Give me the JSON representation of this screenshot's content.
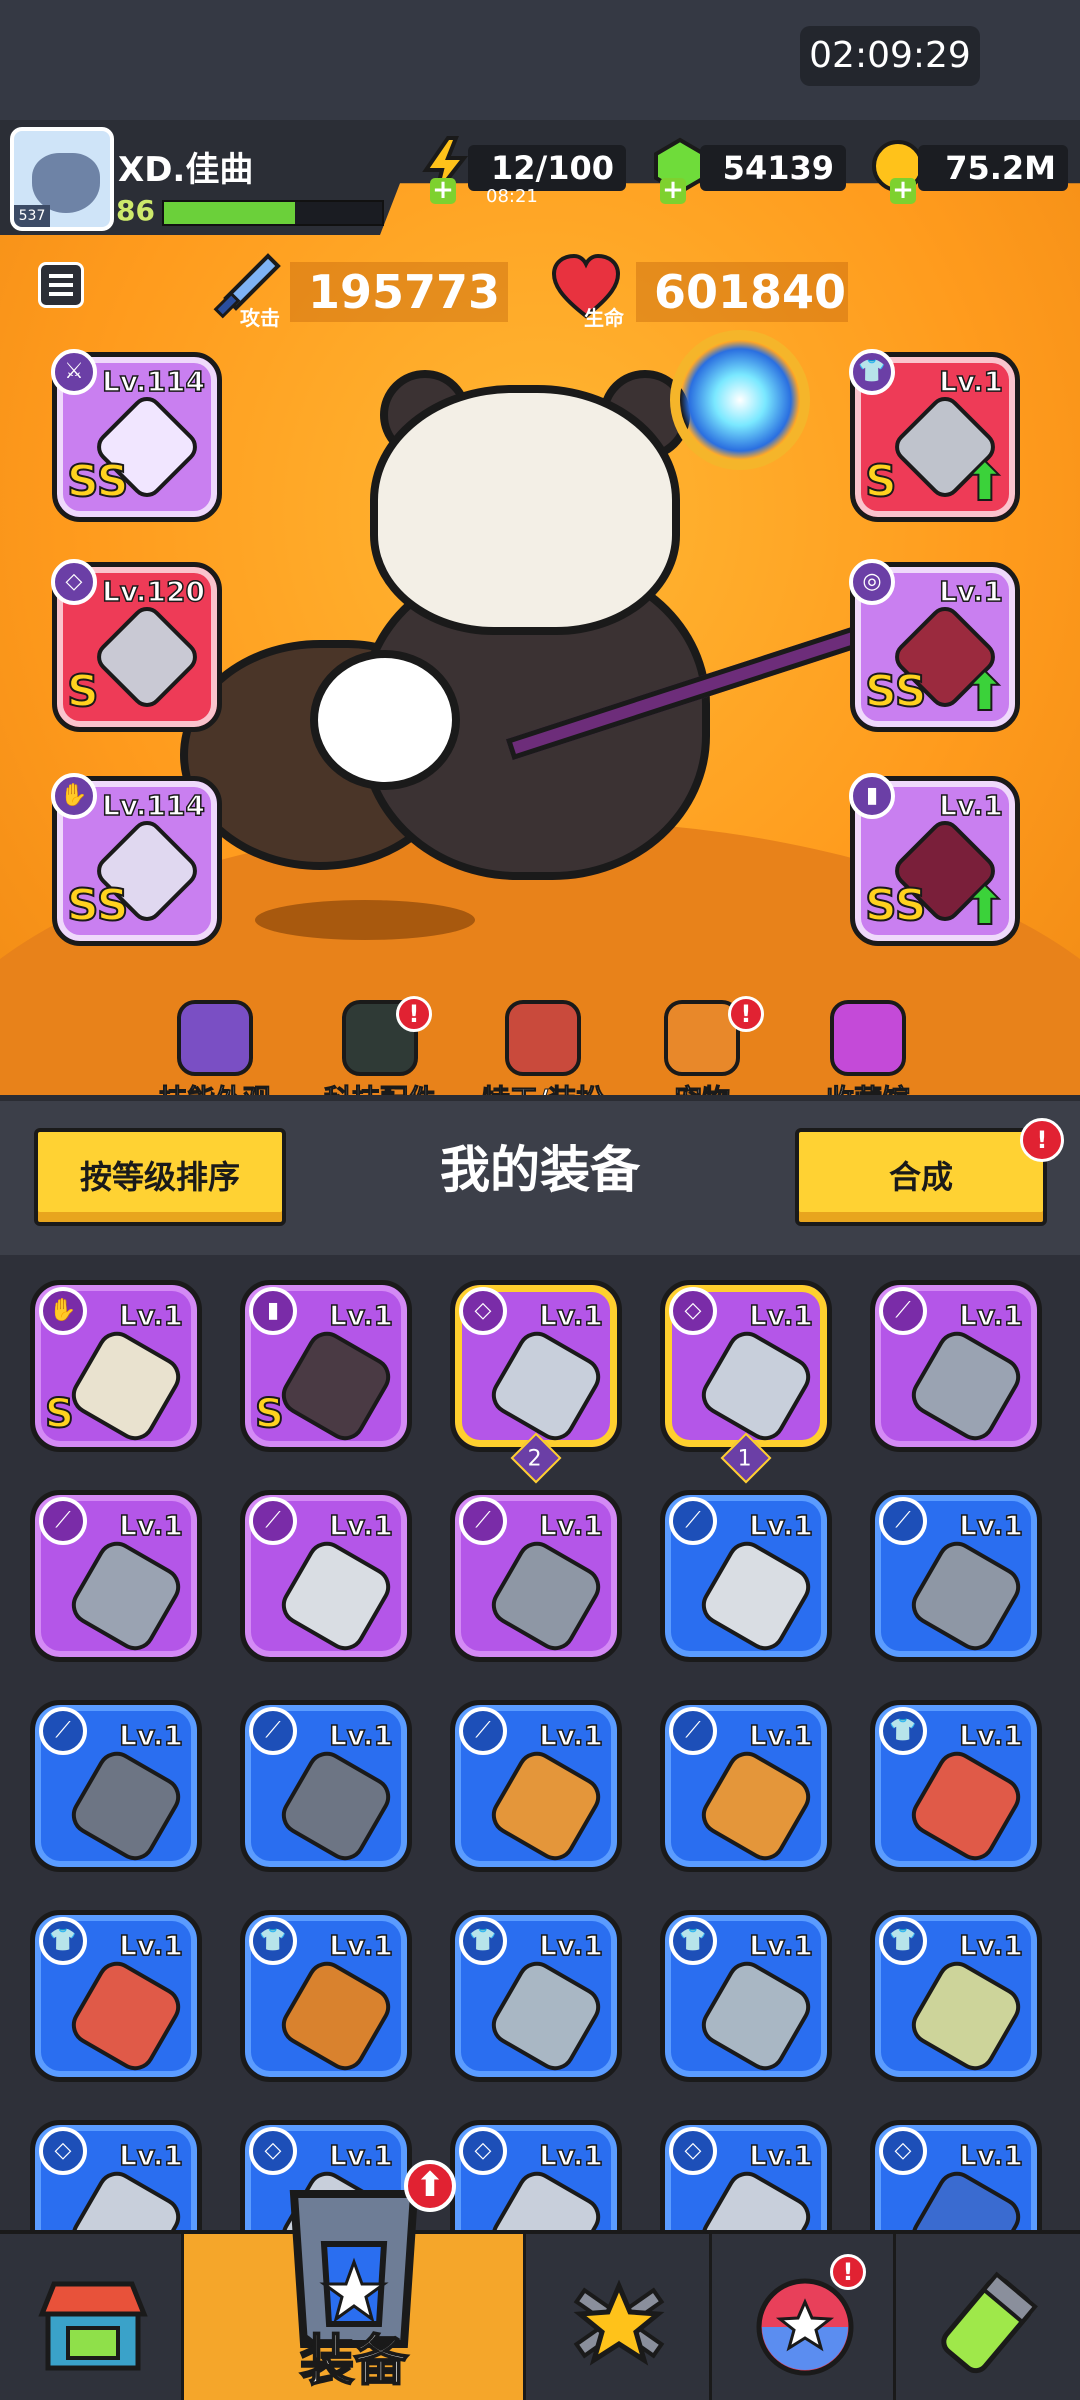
{
  "status_bar": {
    "time": "02:09:29"
  },
  "player": {
    "name": "XD.佳曲",
    "level": "86",
    "avatar_level": "537",
    "xp_progress": 0.6
  },
  "resources": {
    "energy": "12/100",
    "energy_timer": "08:21",
    "gems": "54139",
    "coins": "75.2M"
  },
  "stats": {
    "attack_value": "195773",
    "attack_label": "攻击",
    "hp_value": "601840",
    "hp_label": "生命"
  },
  "equipped": {
    "left": [
      {
        "level": "Lv.114",
        "grade": "SS",
        "slot_icon": "weapon-icon",
        "color": "#c97ff0"
      },
      {
        "level": "Lv.120",
        "grade": "S",
        "slot_icon": "necklace-icon",
        "color": "#ee3b57"
      },
      {
        "level": "Lv.114",
        "grade": "SS",
        "slot_icon": "glove-icon",
        "color": "#c97ff0"
      }
    ],
    "right": [
      {
        "level": "Lv.1",
        "grade": "S",
        "slot_icon": "armor-icon",
        "color": "#ee3b57",
        "upgrade": true
      },
      {
        "level": "Lv.1",
        "grade": "SS",
        "slot_icon": "belt-icon",
        "color": "#c97ff0",
        "upgrade": true
      },
      {
        "level": "Lv.1",
        "grade": "SS",
        "slot_icon": "boots-icon",
        "color": "#c97ff0",
        "upgrade": true
      }
    ]
  },
  "features": [
    {
      "label": "技能外观",
      "icon": "skill-skin-icon",
      "alert": false
    },
    {
      "label": "科技配件",
      "icon": "tech-parts-icon",
      "alert": true
    },
    {
      "label": "特工/装扮",
      "icon": "agent-icon",
      "alert": false
    },
    {
      "label": "宠物",
      "icon": "pet-icon",
      "alert": true
    },
    {
      "label": "收藏馆",
      "icon": "collection-icon",
      "alert": false
    }
  ],
  "equipment_panel": {
    "sort_button": "按等级排序",
    "title": "我的装备",
    "merge_button": "合成",
    "alert_mark": "!"
  },
  "inventory": [
    {
      "level": "Lv.1",
      "rarity": "purple",
      "grade": "S",
      "type": "glove-icon"
    },
    {
      "level": "Lv.1",
      "rarity": "purple",
      "grade": "S",
      "type": "boots-icon"
    },
    {
      "level": "Lv.1",
      "rarity": "purple",
      "grade": "",
      "type": "necklace-icon",
      "highlight": true,
      "count": "2"
    },
    {
      "level": "Lv.1",
      "rarity": "purple",
      "grade": "",
      "type": "necklace-icon",
      "highlight": true,
      "count": "1"
    },
    {
      "level": "Lv.1",
      "rarity": "purple",
      "grade": "",
      "type": "kunai-icon"
    },
    {
      "level": "Lv.1",
      "rarity": "purple",
      "grade": "",
      "type": "kunai-icon"
    },
    {
      "level": "Lv.1",
      "rarity": "purple",
      "grade": "",
      "type": "blade-icon"
    },
    {
      "level": "Lv.1",
      "rarity": "purple",
      "grade": "",
      "type": "revolver-icon"
    },
    {
      "level": "Lv.1",
      "rarity": "blue",
      "grade": "",
      "type": "blade-icon"
    },
    {
      "level": "Lv.1",
      "rarity": "blue",
      "grade": "",
      "type": "revolver-icon"
    },
    {
      "level": "Lv.1",
      "rarity": "blue",
      "grade": "",
      "type": "shotgun-icon"
    },
    {
      "level": "Lv.1",
      "rarity": "blue",
      "grade": "",
      "type": "shotgun-icon"
    },
    {
      "level": "Lv.1",
      "rarity": "blue",
      "grade": "",
      "type": "bat-icon"
    },
    {
      "level": "Lv.1",
      "rarity": "blue",
      "grade": "",
      "type": "bat-icon"
    },
    {
      "level": "Lv.1",
      "rarity": "blue",
      "grade": "",
      "type": "vest-icon"
    },
    {
      "level": "Lv.1",
      "rarity": "blue",
      "grade": "",
      "type": "vest-icon"
    },
    {
      "level": "Lv.1",
      "rarity": "blue",
      "grade": "",
      "type": "jacket-icon"
    },
    {
      "level": "Lv.1",
      "rarity": "blue",
      "grade": "",
      "type": "armor-vest-icon"
    },
    {
      "level": "Lv.1",
      "rarity": "blue",
      "grade": "",
      "type": "armor-vest-icon"
    },
    {
      "level": "Lv.1",
      "rarity": "blue",
      "grade": "",
      "type": "shirt-icon"
    },
    {
      "level": "Lv.1",
      "rarity": "blue",
      "grade": "",
      "type": "necklace-icon"
    },
    {
      "level": "Lv.1",
      "rarity": "blue",
      "grade": "",
      "type": "necklace-icon"
    },
    {
      "level": "Lv.1",
      "rarity": "blue",
      "grade": "",
      "type": "necklace-icon"
    },
    {
      "level": "Lv.1",
      "rarity": "blue",
      "grade": "",
      "type": "necklace-icon"
    },
    {
      "level": "Lv.1",
      "rarity": "blue",
      "grade": "",
      "type": "belt-icon"
    }
  ],
  "bottom_nav": [
    {
      "label": "",
      "icon": "shop-icon",
      "active": false
    },
    {
      "label": "装备",
      "icon": "equipment-icon",
      "active": true,
      "upgrade": true
    },
    {
      "label": "",
      "icon": "battle-star-icon",
      "active": false
    },
    {
      "label": "",
      "icon": "gacha-ball-icon",
      "active": false,
      "alert": true
    },
    {
      "label": "",
      "icon": "gene-capsule-icon",
      "active": false
    }
  ],
  "colors": {
    "purple_rarity": "#b456e8",
    "blue_rarity": "#2a6ef0",
    "red_rarity": "#ee3b57",
    "accent_yellow": "#ffd233",
    "alert_red": "#e12232"
  }
}
